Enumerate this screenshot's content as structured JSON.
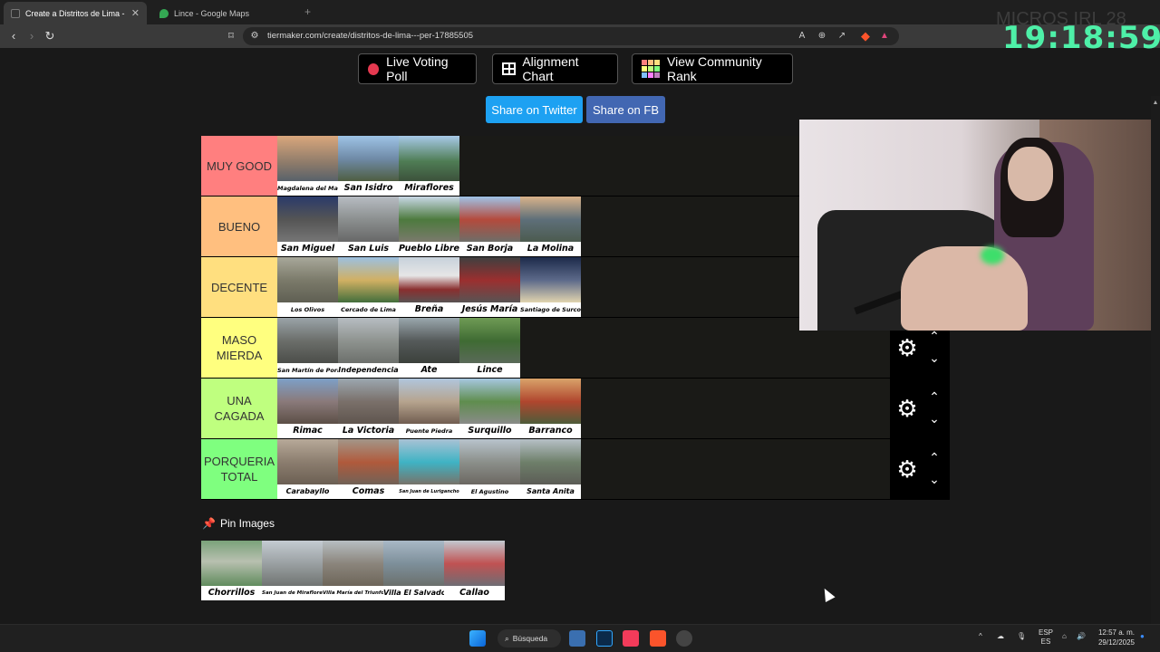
{
  "browser": {
    "tabs": [
      {
        "title": "Create a Distritos de Lima - Peru",
        "active": true
      },
      {
        "title": "Lince - Google Maps",
        "active": false
      }
    ],
    "url": "tiermaker.com/create/distritos-de-lima---per-17885505"
  },
  "toolbar_buttons": {
    "live_poll": "Live Voting Poll",
    "alignment": "Alignment Chart",
    "community": "View Community Rank"
  },
  "share": {
    "twitter": "Share on Twitter",
    "fb": "Share on FB"
  },
  "tiers": [
    {
      "label": "MUY GOOD",
      "color": "#ff7f7f",
      "items": [
        "Magdalena del Mar",
        "San Isidro",
        "Miraflores"
      ]
    },
    {
      "label": "BUENO",
      "color": "#ffbf7f",
      "items": [
        "San Miguel",
        "San Luis",
        "Pueblo Libre",
        "San Borja",
        "La Molina"
      ]
    },
    {
      "label": "DECENTE",
      "color": "#ffdf7f",
      "items": [
        "Los Olivos",
        "Cercado de Lima",
        "Breña",
        "Jesús María",
        "Santiago de Surco"
      ]
    },
    {
      "label": "MASO MIERDA",
      "color": "#ffff7f",
      "items": [
        "San Martín de Porres",
        "Independencia",
        "Ate",
        "Lince"
      ]
    },
    {
      "label": "UNA CAGADA",
      "color": "#bfff7f",
      "items": [
        "Rimac",
        "La Victoria",
        "Puente Piedra",
        "Surquillo",
        "Barranco"
      ]
    },
    {
      "label": "PORQUERIA TOTAL",
      "color": "#7fff7f",
      "items": [
        "Carabayllo",
        "Comas",
        "San Juan de Lurigancho",
        "El Agustino",
        "Santa Anita"
      ]
    }
  ],
  "pin": {
    "label": "Pin Images",
    "items": [
      "Chorrillos",
      "San Juan de Miraflores",
      "Villa María del Triunfo",
      "Villa El Salvador",
      "Callao"
    ]
  },
  "overlay": {
    "clock": "19:18:59",
    "ghost": "MICROS IRL 28"
  },
  "taskbar": {
    "search": "Búsqueda",
    "lang_top": "ESP",
    "lang_bottom": "ES",
    "time": "12:57 a. m.",
    "date": "29/12/2025"
  }
}
